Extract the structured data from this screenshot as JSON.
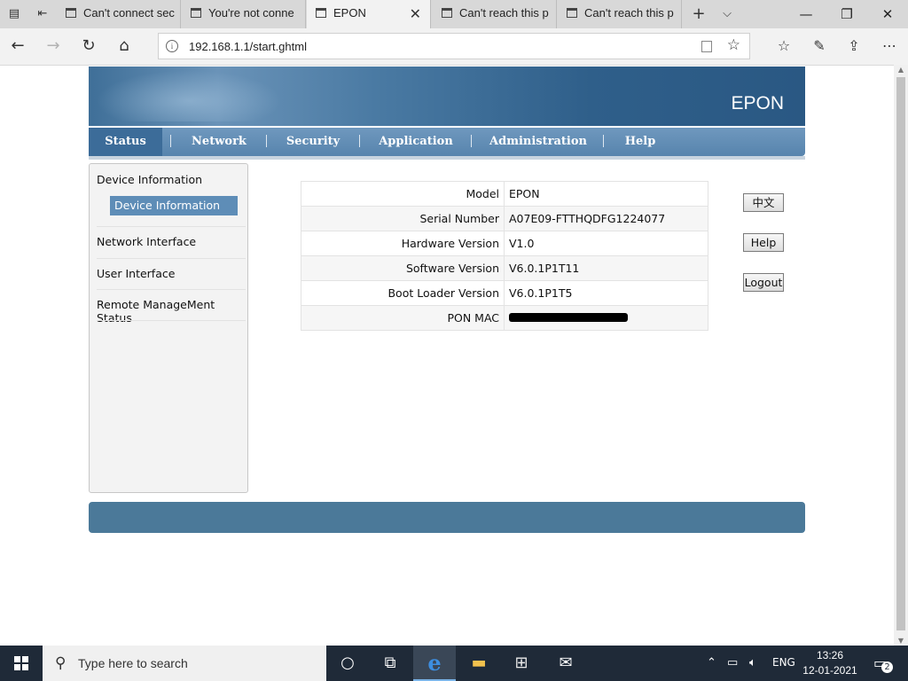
{
  "browser": {
    "tabs": [
      {
        "title": "Can't connect sec",
        "active": false
      },
      {
        "title": "You're not conne",
        "active": false
      },
      {
        "title": "EPON",
        "active": true
      },
      {
        "title": "Can't reach this p",
        "active": false
      },
      {
        "title": "Can't reach this p",
        "active": false
      }
    ],
    "new_tab_label": "+",
    "address": "192.168.1.1/start.ghtml"
  },
  "header": {
    "brand": "EPON"
  },
  "menu": {
    "items": [
      {
        "label": "Status",
        "active": true
      },
      {
        "label": "Network",
        "active": false
      },
      {
        "label": "Security",
        "active": false
      },
      {
        "label": "Application",
        "active": false
      },
      {
        "label": "Administration",
        "active": false
      },
      {
        "label": "Help",
        "active": false
      }
    ]
  },
  "sidebar": {
    "sections": [
      {
        "label": "Device Information"
      },
      {
        "label": "Network Interface"
      },
      {
        "label": "User Interface"
      },
      {
        "label": "Remote ManageMent Status"
      }
    ],
    "selected_sub": "Device Information"
  },
  "device_info": {
    "rows": [
      {
        "label": "Model",
        "value": "EPON"
      },
      {
        "label": "Serial Number",
        "value": "A07E09-FTTHQDFG1224077"
      },
      {
        "label": "Hardware Version",
        "value": "V1.0"
      },
      {
        "label": "Software Version",
        "value": "V6.0.1P1T11"
      },
      {
        "label": "Boot Loader Version",
        "value": "V6.0.1P1T5"
      },
      {
        "label": "PON MAC",
        "value": ""
      }
    ]
  },
  "actions": {
    "language": "中文",
    "help": "Help",
    "logout": "Logout"
  },
  "taskbar": {
    "search_placeholder": "Type here to search",
    "language": "ENG",
    "time": "13:26",
    "date": "12-01-2021",
    "notifications": "2"
  },
  "colors": {
    "menu": "#5e8db7",
    "banner": "#3a6a95",
    "footer": "#4b7999"
  }
}
